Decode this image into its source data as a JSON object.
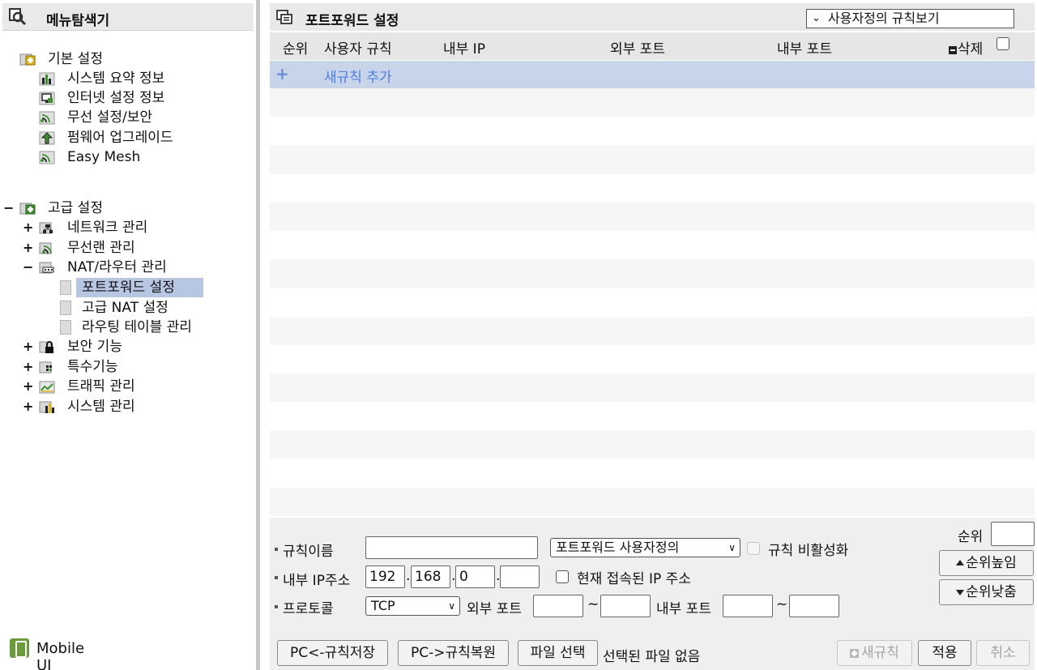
{
  "left_panel": {
    "title": "메뉴탐색기",
    "basic": {
      "label": "기본 설정",
      "items": [
        {
          "label": "시스템 요약 정보",
          "icon": "bar-chart-icon"
        },
        {
          "label": "인터넷 설정 정보",
          "icon": "monitor-icon"
        },
        {
          "label": "무선 설정/보안",
          "icon": "wifi-icon"
        },
        {
          "label": "펌웨어 업그레이드",
          "icon": "upgrade-arrow-icon"
        },
        {
          "label": "Easy Mesh",
          "icon": "wifi-icon"
        }
      ]
    },
    "advanced": {
      "toggle": "−",
      "label": "고급 설정",
      "items": [
        {
          "toggle": "+",
          "label": "네트워크 관리",
          "icon": "network-icon"
        },
        {
          "toggle": "+",
          "label": "무선랜 관리",
          "icon": "wifi-icon"
        },
        {
          "toggle": "−",
          "label": "NAT/라우터 관리",
          "icon": "router-icon",
          "children": [
            "포트포워드 설정",
            "고급 NAT 설정",
            "라우팅 테이블 관리"
          ]
        },
        {
          "toggle": "+",
          "label": "보안 기능",
          "icon": "lock-icon"
        },
        {
          "toggle": "+",
          "label": "특수기능",
          "icon": "special-icon"
        },
        {
          "toggle": "+",
          "label": "트래픽 관리",
          "icon": "traffic-chart-icon"
        },
        {
          "toggle": "+",
          "label": "시스템 관리",
          "icon": "bar-chart-icon"
        }
      ]
    },
    "mobile_ui": "Mobile UI"
  },
  "right_panel": {
    "title": "포트포워드 설정",
    "view_select": "사용자정의 규칙보기",
    "columns": [
      "순위",
      "사용자 규칙",
      "내부 IP",
      "외부 포트",
      "내부 포트",
      "삭제"
    ],
    "add_rule": {
      "plus": "+",
      "label": "새규칙 추가"
    },
    "form": {
      "rule_name_label": "규칙이름",
      "rule_name_value": "",
      "type_select": "포트포워드 사용자정의",
      "disable_label": "규칙 비활성화",
      "ip_label": "내부 IP주소",
      "ip1": "192",
      "ip2": "168",
      "ip3": "0",
      "ip4": "",
      "current_ip_label": "현재 접속된 IP 주소",
      "protocol_label": "프로토콜",
      "protocol_value": "TCP",
      "ext_port_label": "외부 포트",
      "int_port_label": "내부 포트",
      "tilde": "~",
      "dot": ".",
      "rank_label": "순위",
      "rank_up": "순위높임",
      "rank_down": "순위낮춤",
      "save_pc": "PC<-규칙저장",
      "restore_pc": "PC->규칙복원",
      "file_select": "파일 선택",
      "no_file": "선택된 파일 없음",
      "new_rule": "새규칙",
      "apply": "적용",
      "cancel": "취소"
    }
  },
  "colors": {
    "header_bg": "#e9e9e9",
    "selected_bg": "#b7c6e3",
    "add_row_bg": "#c7d4ea",
    "link_blue": "#4f7ee0",
    "icon_green": "#3f8f2f",
    "icon_yellow": "#e3b21b"
  }
}
